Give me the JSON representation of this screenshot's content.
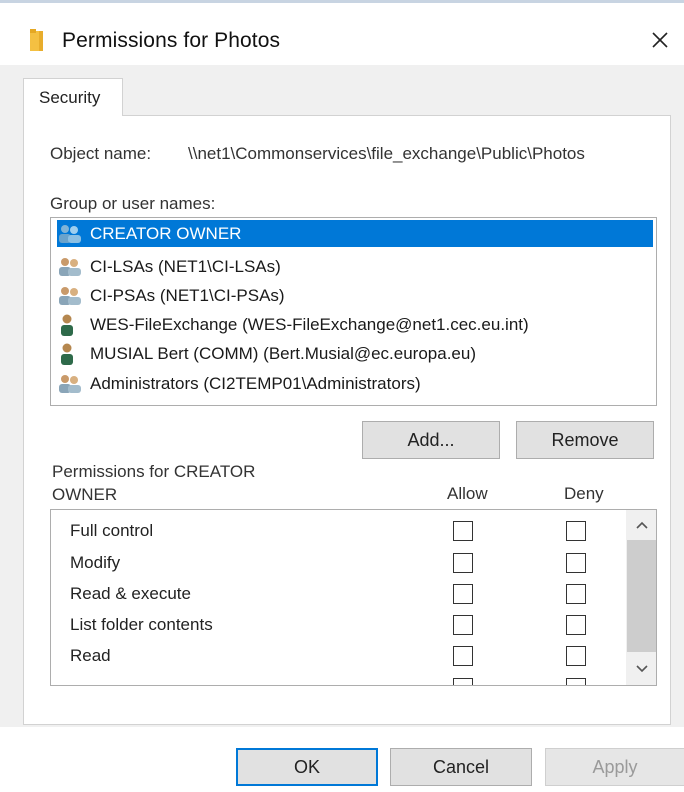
{
  "window": {
    "title": "Permissions for Photos",
    "title_icon": "folder-icon",
    "close_icon": "close-icon"
  },
  "tabs": [
    {
      "label": "Security",
      "active": true
    }
  ],
  "object_name": {
    "label": "Object name:",
    "value": "\\\\net1\\Commonservices\\file_exchange\\Public\\Photos"
  },
  "group_or_user_names": {
    "label": "Group or user names:",
    "items": [
      {
        "label": "CREATOR OWNER",
        "icon": "group-users-icon",
        "selected": true
      },
      {
        "label": "CI-LSAs (NET1\\CI-LSAs)",
        "icon": "group-users-icon",
        "selected": false
      },
      {
        "label": "CI-PSAs (NET1\\CI-PSAs)",
        "icon": "group-users-icon",
        "selected": false
      },
      {
        "label": "WES-FileExchange (WES-FileExchange@net1.cec.eu.int)",
        "icon": "user-icon",
        "selected": false
      },
      {
        "label": "MUSIAL Bert (COMM) (Bert.Musial@ec.europa.eu)",
        "icon": "user-icon",
        "selected": false
      },
      {
        "label": "Administrators (CI2TEMP01\\Administrators)",
        "icon": "group-users-icon",
        "selected": false
      }
    ]
  },
  "buttons": {
    "add": "Add...",
    "remove": "Remove",
    "ok": "OK",
    "cancel": "Cancel",
    "apply": "Apply"
  },
  "permissions": {
    "label_line1": "Permissions for CREATOR",
    "label_line2": "OWNER",
    "allow_header": "Allow",
    "deny_header": "Deny",
    "items": [
      {
        "name": "Full control",
        "allow": false,
        "deny": false
      },
      {
        "name": "Modify",
        "allow": false,
        "deny": false
      },
      {
        "name": "Read & execute",
        "allow": false,
        "deny": false
      },
      {
        "name": "List folder contents",
        "allow": false,
        "deny": false
      },
      {
        "name": "Read",
        "allow": false,
        "deny": false
      }
    ]
  },
  "colors": {
    "selection": "#0078d7",
    "dialog_bg": "#f0f0f0",
    "folder": "#f4c042"
  }
}
